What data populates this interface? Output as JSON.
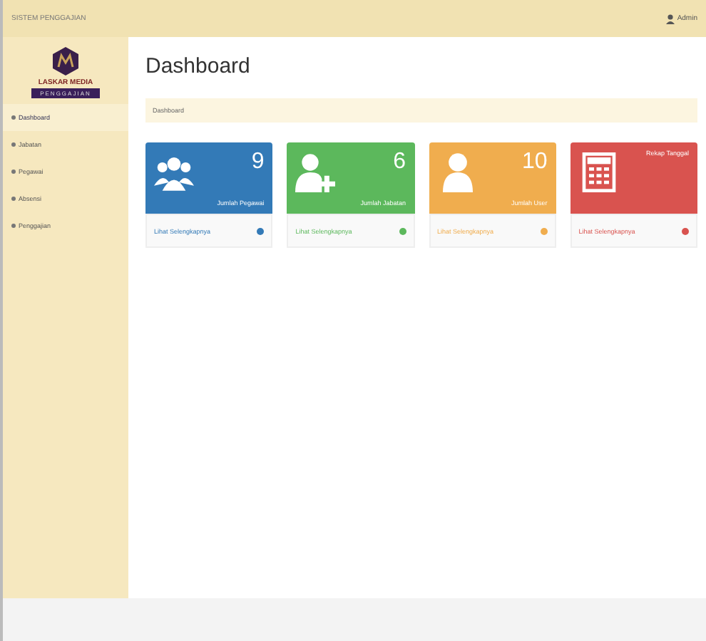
{
  "topbar": {
    "title": "SISTEM PENGGAJIAN",
    "user": "Admin"
  },
  "logo": {
    "name": "LASKAR MEDIA",
    "tagline": "PENGGAJIAN"
  },
  "sidebar": {
    "items": [
      {
        "label": "Dashboard",
        "selected": true
      },
      {
        "label": "Jabatan",
        "selected": false
      },
      {
        "label": "Pegawai",
        "selected": false
      },
      {
        "label": "Absensi",
        "selected": false
      },
      {
        "label": "Penggajian",
        "selected": false
      }
    ]
  },
  "page_title": "Dashboard",
  "breadcrumb": "Dashboard",
  "cards": [
    {
      "kind": "group",
      "color": "#337ab7",
      "value": "9",
      "caption": "Jumlah Pegawai",
      "link": "Lihat Selengkapnya"
    },
    {
      "kind": "add",
      "color": "#5cb85c",
      "value": "6",
      "caption": "Jumlah Jabatan",
      "link": "Lihat Selengkapnya"
    },
    {
      "kind": "user",
      "color": "#f0ad4e",
      "value": "10",
      "caption": "Jumlah User",
      "link": "Lihat Selengkapnya"
    },
    {
      "kind": "calendar",
      "color": "#d9534f",
      "caption": "Rekap Tanggal",
      "link": "Lihat Selengkapnya"
    }
  ]
}
